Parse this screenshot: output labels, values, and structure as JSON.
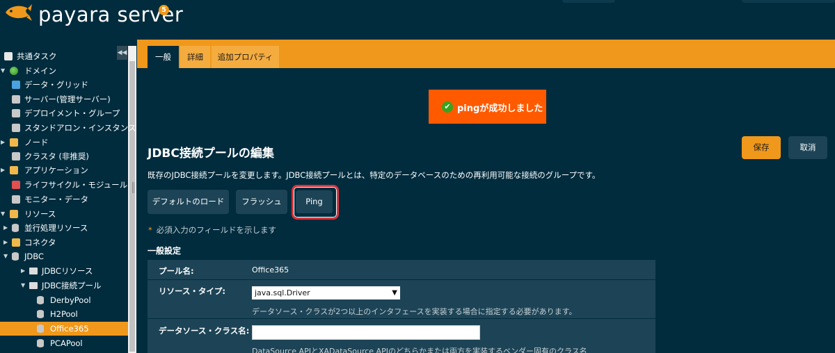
{
  "app": {
    "brand": "payara server",
    "version": "5"
  },
  "sidebar": {
    "items": [
      {
        "label": "共通タスク",
        "icon": "common-tasks-icon",
        "indent": 0,
        "arrow": ""
      },
      {
        "label": "ドメイン",
        "icon": "globe-icon",
        "indent": 0,
        "arrow": "▼"
      },
      {
        "label": "データ・グリッド",
        "icon": "data-grid-icon",
        "indent": 1,
        "arrow": ""
      },
      {
        "label": "サーバー(管理サーバー)",
        "icon": "server-icon",
        "indent": 1,
        "arrow": ""
      },
      {
        "label": "デプロイメント・グループ",
        "icon": "deployment-group-icon",
        "indent": 1,
        "arrow": ""
      },
      {
        "label": "スタンドアロン・インスタンス",
        "icon": "server-icon",
        "indent": 1,
        "arrow": ""
      },
      {
        "label": "ノード",
        "icon": "node-icon",
        "indent": 0,
        "arrow": "▶"
      },
      {
        "label": "クラスタ (非推奨)",
        "icon": "cluster-icon",
        "indent": 1,
        "arrow": ""
      },
      {
        "label": "アプリケーション",
        "icon": "application-icon",
        "indent": 0,
        "arrow": "▶"
      },
      {
        "label": "ライフサイクル・モジュール",
        "icon": "lifecycle-icon",
        "indent": 1,
        "arrow": ""
      },
      {
        "label": "モニター・データ",
        "icon": "monitor-icon",
        "indent": 1,
        "arrow": ""
      },
      {
        "label": "リソース",
        "icon": "resources-icon",
        "indent": 0,
        "arrow": "▼"
      },
      {
        "label": "並行処理リソース",
        "icon": "database-icon",
        "indent": 1,
        "arrow": "▶"
      },
      {
        "label": "コネクタ",
        "icon": "connector-icon",
        "indent": 1,
        "arrow": "▶"
      },
      {
        "label": "JDBC",
        "icon": "database-icon",
        "indent": 1,
        "arrow": "▼"
      },
      {
        "label": "JDBCリソース",
        "icon": "folder-icon",
        "indent": 2,
        "arrow": "▶"
      },
      {
        "label": "JDBC接続プール",
        "icon": "folder-icon",
        "indent": 2,
        "arrow": "▼"
      },
      {
        "label": "DerbyPool",
        "icon": "database-icon",
        "indent": 3,
        "arrow": ""
      },
      {
        "label": "H2Pool",
        "icon": "database-icon",
        "indent": 3,
        "arrow": ""
      },
      {
        "label": "Office365",
        "icon": "database-icon",
        "indent": 3,
        "arrow": "",
        "active": true
      },
      {
        "label": "PCAPool",
        "icon": "database-icon",
        "indent": 3,
        "arrow": ""
      }
    ]
  },
  "tabs": [
    {
      "label": "一般",
      "active": true
    },
    {
      "label": "詳細",
      "active": false
    },
    {
      "label": "追加プロパティ",
      "active": false
    }
  ],
  "message": {
    "text": "pingが成功しました"
  },
  "page": {
    "title": "JDBC接続プールの編集",
    "description": "既存のJDBC接続プールを変更します。JDBC接続プールとは、特定のデータベースのための再利用可能な接続のグループです。",
    "save_label": "保存",
    "cancel_label": "取消"
  },
  "actions": {
    "load_defaults": "デフォルトのロード",
    "flush": "フラッシュ",
    "ping": "Ping"
  },
  "required_note": "必須入力のフィールドを示します",
  "required_mark": "*",
  "section_title": "一般設定",
  "props": {
    "pool_name_label": "プール名:",
    "pool_name_value": "Office365",
    "resource_type_label": "リソース・タイプ:",
    "resource_type_value": "java.sql.Driver",
    "resource_type_help": "データソース・クラスが2つ以上のインタフェースを実装する場合に指定する必要があります。",
    "ds_class_label": "データソース・クラス名:",
    "ds_class_value": "",
    "ds_class_help": "DataSource APIとXADataSource APIのどちらかまたは両方を実装するベンダー固有のクラス名"
  },
  "colors": {
    "accent": "#f0981b",
    "background": "#002c3e",
    "panel": "#1d4456",
    "alert": "#ff5a00"
  }
}
